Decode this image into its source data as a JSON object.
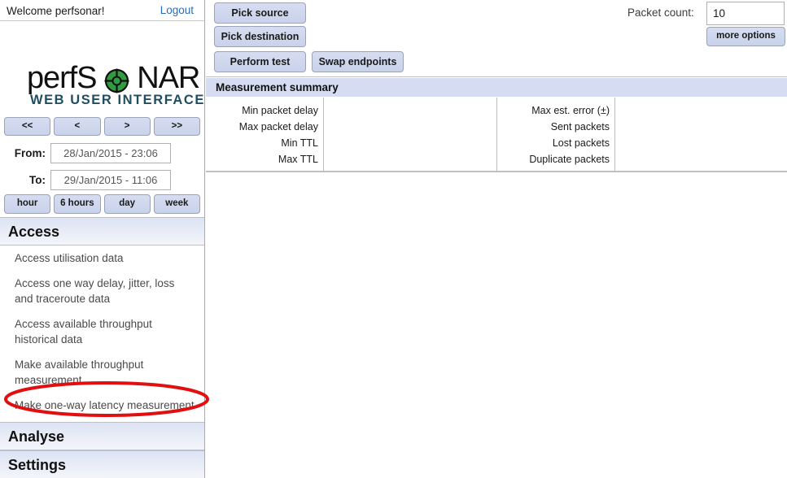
{
  "sidebar": {
    "welcome": "Welcome perfsonar!",
    "logout_label": "Logout",
    "logo": {
      "word_pre": "perfS",
      "word_post": "NAR",
      "o_icon": "crosshair-globe-icon",
      "o_color": "#2f9e41",
      "subtitle": "WEB USER INTERFACE",
      "subtitle_color": "#1f4e63"
    },
    "nav_buttons": [
      {
        "label": "<<",
        "name": "nav-first"
      },
      {
        "label": "<",
        "name": "nav-prev"
      },
      {
        "label": ">",
        "name": "nav-next"
      },
      {
        "label": ">>",
        "name": "nav-last"
      }
    ],
    "date_from": {
      "label": "From:",
      "value": "28/Jan/2015 - 23:06"
    },
    "date_to": {
      "label": "To:",
      "value": "29/Jan/2015 - 11:06"
    },
    "range_buttons": [
      {
        "label": "hour",
        "name": "range-hour"
      },
      {
        "label": "6 hours",
        "name": "range-6-hours"
      },
      {
        "label": "day",
        "name": "range-day"
      },
      {
        "label": "week",
        "name": "range-week"
      }
    ],
    "sections": [
      {
        "label": "Access",
        "name": "section-access"
      },
      {
        "label": "Analyse",
        "name": "section-analyse"
      },
      {
        "label": "Settings",
        "name": "section-settings"
      }
    ],
    "access_items": [
      "Access utilisation data",
      "Access one way delay, jitter, loss and traceroute data",
      "Access available throughput historical data",
      "Make available throughput measurement",
      "Make one-way latency measurement"
    ]
  },
  "annotation": {
    "shape": "ellipse",
    "color": "#e10f0f",
    "stroke_width": 4,
    "targets": "Make one-way latency measurement"
  },
  "toolbar": {
    "pick_source": "Pick source",
    "pick_destination": "Pick destination",
    "perform_test": "Perform test",
    "swap_endpoints": "Swap endpoints",
    "packet_count_label": "Packet count:",
    "packet_count_value": "10",
    "more_options": "more options"
  },
  "summary": {
    "title": "Measurement summary",
    "left_labels": [
      "Min packet delay",
      "Max packet delay",
      "Min TTL",
      "Max TTL"
    ],
    "left_values": [
      "",
      "",
      "",
      ""
    ],
    "right_labels": [
      "Max est. error (±)",
      "Sent packets",
      "Lost packets",
      "Duplicate packets"
    ],
    "right_values": [
      "",
      "",
      "",
      ""
    ]
  },
  "colors": {
    "button_face": "#d0d9ed",
    "panel_header": "#d6ddf2",
    "link": "#2a6db5",
    "section_gradient_top": "#dde3f3",
    "annotation_red": "#e10f0f"
  }
}
